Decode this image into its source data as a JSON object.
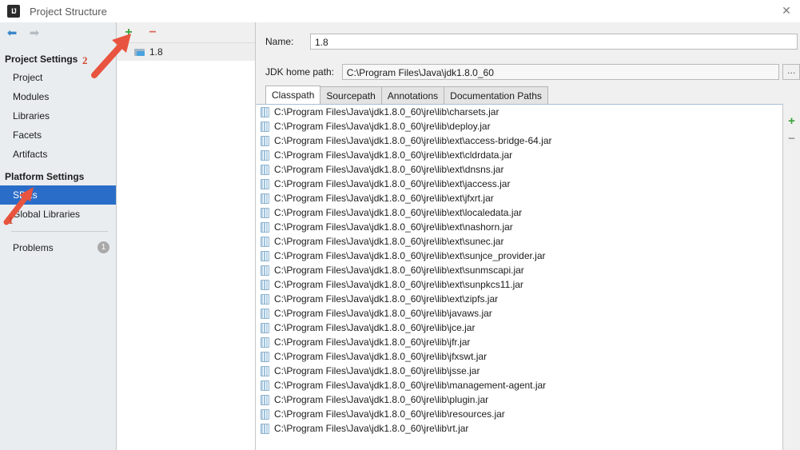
{
  "window": {
    "title": "Project Structure",
    "app_icon": "IJ",
    "close_icon": "✕"
  },
  "nav": {
    "back_icon": "⬅",
    "forward_icon": "➡",
    "groups": [
      {
        "title": "Project Settings",
        "items": [
          {
            "label": "Project",
            "selected": false
          },
          {
            "label": "Modules",
            "selected": false
          },
          {
            "label": "Libraries",
            "selected": false
          },
          {
            "label": "Facets",
            "selected": false
          },
          {
            "label": "Artifacts",
            "selected": false
          }
        ]
      },
      {
        "title": "Platform Settings",
        "items": [
          {
            "label": "SDKs",
            "selected": true
          },
          {
            "label": "Global Libraries",
            "selected": false
          }
        ]
      }
    ],
    "problems": {
      "label": "Problems",
      "badge": "1"
    }
  },
  "sdk_panel": {
    "add_icon": "+",
    "remove_icon": "−",
    "items": [
      {
        "label": "1.8",
        "icon": "sdk-icon",
        "selected": true
      }
    ]
  },
  "detail": {
    "name_label": "Name:",
    "name_value": "1.8",
    "path_label": "JDK home path:",
    "path_value": "C:\\Program Files\\Java\\jdk1.8.0_60",
    "browse_label": "…",
    "tabs": [
      {
        "label": "Classpath",
        "active": true
      },
      {
        "label": "Sourcepath",
        "active": false
      },
      {
        "label": "Annotations",
        "active": false
      },
      {
        "label": "Documentation Paths",
        "active": false
      }
    ],
    "classpath_add_icon": "+",
    "classpath_remove_icon": "−",
    "classpath_entries": [
      "C:\\Program Files\\Java\\jdk1.8.0_60\\jre\\lib\\charsets.jar",
      "C:\\Program Files\\Java\\jdk1.8.0_60\\jre\\lib\\deploy.jar",
      "C:\\Program Files\\Java\\jdk1.8.0_60\\jre\\lib\\ext\\access-bridge-64.jar",
      "C:\\Program Files\\Java\\jdk1.8.0_60\\jre\\lib\\ext\\cldrdata.jar",
      "C:\\Program Files\\Java\\jdk1.8.0_60\\jre\\lib\\ext\\dnsns.jar",
      "C:\\Program Files\\Java\\jdk1.8.0_60\\jre\\lib\\ext\\jaccess.jar",
      "C:\\Program Files\\Java\\jdk1.8.0_60\\jre\\lib\\ext\\jfxrt.jar",
      "C:\\Program Files\\Java\\jdk1.8.0_60\\jre\\lib\\ext\\localedata.jar",
      "C:\\Program Files\\Java\\jdk1.8.0_60\\jre\\lib\\ext\\nashorn.jar",
      "C:\\Program Files\\Java\\jdk1.8.0_60\\jre\\lib\\ext\\sunec.jar",
      "C:\\Program Files\\Java\\jdk1.8.0_60\\jre\\lib\\ext\\sunjce_provider.jar",
      "C:\\Program Files\\Java\\jdk1.8.0_60\\jre\\lib\\ext\\sunmscapi.jar",
      "C:\\Program Files\\Java\\jdk1.8.0_60\\jre\\lib\\ext\\sunpkcs11.jar",
      "C:\\Program Files\\Java\\jdk1.8.0_60\\jre\\lib\\ext\\zipfs.jar",
      "C:\\Program Files\\Java\\jdk1.8.0_60\\jre\\lib\\javaws.jar",
      "C:\\Program Files\\Java\\jdk1.8.0_60\\jre\\lib\\jce.jar",
      "C:\\Program Files\\Java\\jdk1.8.0_60\\jre\\lib\\jfr.jar",
      "C:\\Program Files\\Java\\jdk1.8.0_60\\jre\\lib\\jfxswt.jar",
      "C:\\Program Files\\Java\\jdk1.8.0_60\\jre\\lib\\jsse.jar",
      "C:\\Program Files\\Java\\jdk1.8.0_60\\jre\\lib\\management-agent.jar",
      "C:\\Program Files\\Java\\jdk1.8.0_60\\jre\\lib\\plugin.jar",
      "C:\\Program Files\\Java\\jdk1.8.0_60\\jre\\lib\\resources.jar",
      "C:\\Program Files\\Java\\jdk1.8.0_60\\jre\\lib\\rt.jar"
    ]
  },
  "annotations": {
    "color": "#d0442e",
    "markers": [
      {
        "number": "1",
        "points_at": "SDKs"
      },
      {
        "number": "2",
        "points_at": "add-sdk-button"
      }
    ]
  }
}
